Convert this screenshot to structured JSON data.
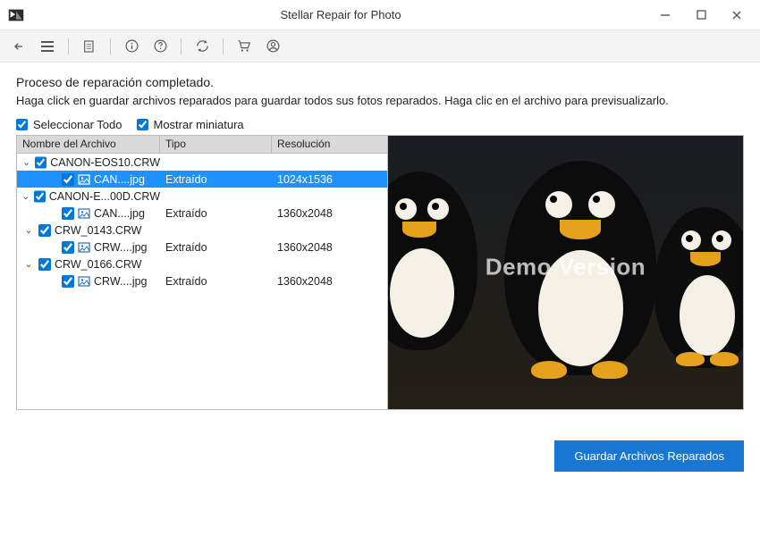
{
  "window": {
    "title": "Stellar Repair for Photo"
  },
  "toolbar": {
    "icons": [
      "back",
      "menu",
      "list",
      "info",
      "help",
      "refresh",
      "cart",
      "account"
    ]
  },
  "status": {
    "heading": "Proceso de reparación completado.",
    "sub": "Haga click en guardar archivos reparados para guardar todos sus fotos reparados. Haga clic en el archivo para previsualizarlo."
  },
  "options": {
    "select_all_label": "Seleccionar Todo",
    "select_all_checked": true,
    "show_thumb_label": "Mostrar miniatura",
    "show_thumb_checked": true
  },
  "columns": {
    "name": "Nombre del Archivo",
    "type": "Tipo",
    "resolution": "Resolución"
  },
  "tree": [
    {
      "filename": "CANON-EOS10.CRW",
      "checked": true,
      "expanded": true,
      "children": [
        {
          "filename": "CAN....jpg",
          "type": "Extraído",
          "resolution": "1024x1536",
          "checked": true,
          "selected": true
        }
      ]
    },
    {
      "filename": "CANON-E...00D.CRW",
      "checked": true,
      "expanded": true,
      "children": [
        {
          "filename": "CAN....jpg",
          "type": "Extraído",
          "resolution": "1360x2048",
          "checked": true,
          "selected": false
        }
      ]
    },
    {
      "filename": "CRW_0143.CRW",
      "checked": true,
      "expanded": true,
      "children": [
        {
          "filename": "CRW....jpg",
          "type": "Extraído",
          "resolution": "1360x2048",
          "checked": true,
          "selected": false
        }
      ]
    },
    {
      "filename": "CRW_0166.CRW",
      "checked": true,
      "expanded": true,
      "children": [
        {
          "filename": "CRW....jpg",
          "type": "Extraído",
          "resolution": "1360x2048",
          "checked": true,
          "selected": false
        }
      ]
    }
  ],
  "preview": {
    "watermark": "Demo Version"
  },
  "actions": {
    "save_label": "Guardar Archivos Reparados"
  }
}
